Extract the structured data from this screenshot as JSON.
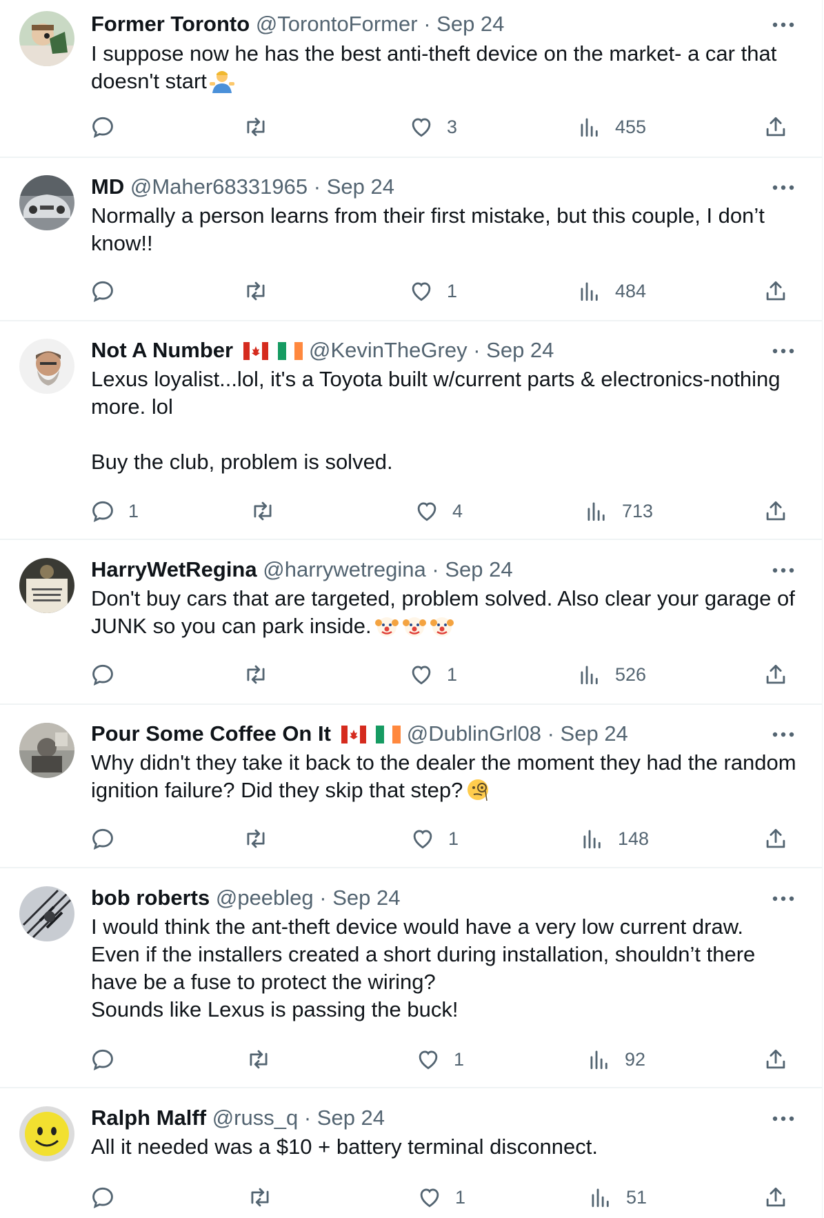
{
  "tweets": [
    {
      "name": "Former Toronto",
      "flags": false,
      "handle": "@TorontoFormer",
      "dot": "·",
      "date": "Sep 24",
      "text": "I suppose now he has the best anti-theft device on the market- a car that doesn't start",
      "emoji": "person-shrugging",
      "replies": "",
      "likes": "3",
      "views": "455"
    },
    {
      "name": "MD",
      "flags": false,
      "handle": "@Maher68331965",
      "dot": "·",
      "date": "Sep 24",
      "text": "Normally a person learns from their first mistake, but this couple, I don’t know!!",
      "emoji": "",
      "replies": "",
      "likes": "1",
      "views": "484"
    },
    {
      "name": "Not A Number",
      "flags": true,
      "handle": "@KevinTheGrey",
      "dot": "·",
      "date": "Sep 24",
      "text": "Lexus loyalist...lol, it's a Toyota built w/current parts & electronics-nothing more. lol\n\nBuy the club, problem is solved.",
      "emoji": "",
      "replies": "1",
      "likes": "4",
      "views": "713"
    },
    {
      "name": "HarryWetRegina",
      "flags": false,
      "handle": "@harrywetregina",
      "dot": "·",
      "date": "Sep 24",
      "text": "Don't buy cars that are targeted, problem solved. Also clear your garage of JUNK so you can park inside.",
      "emoji": "clown-face-x3",
      "replies": "",
      "likes": "1",
      "views": "526"
    },
    {
      "name": "Pour Some Coffee On It",
      "flags": true,
      "handle": "@DublinGrl08",
      "dot": "·",
      "date": "Sep 24",
      "text": "Why didn't they take it back to the dealer the moment they had the random ignition failure? Did they skip that step?",
      "emoji": "face-with-monocle",
      "replies": "",
      "likes": "1",
      "views": "148"
    },
    {
      "name": "bob roberts",
      "flags": false,
      "handle": "@peebleg",
      "dot": "·",
      "date": "Sep 24",
      "text": "I would think the ant-theft device would have a very low current draw.\nEven if the installers created a short during installation, shouldn’t there have be a fuse to protect the wiring?\nSounds like Lexus is passing the buck!",
      "emoji": "",
      "replies": "",
      "likes": "1",
      "views": "92"
    },
    {
      "name": "Ralph Malff",
      "flags": false,
      "handle": "@russ_q",
      "dot": "·",
      "date": "Sep 24",
      "text": "All it needed was a $10 + battery terminal disconnect.",
      "emoji": "",
      "replies": "",
      "likes": "1",
      "views": "51"
    }
  ],
  "icons": {
    "reply": "reply-icon",
    "retweet": "retweet-icon",
    "like": "heart-icon",
    "views": "views-icon",
    "share": "share-icon",
    "more": "more-options-icon"
  },
  "colors": {
    "text": "#0f1419",
    "secondary": "#536471",
    "divider": "#eff3f4"
  }
}
